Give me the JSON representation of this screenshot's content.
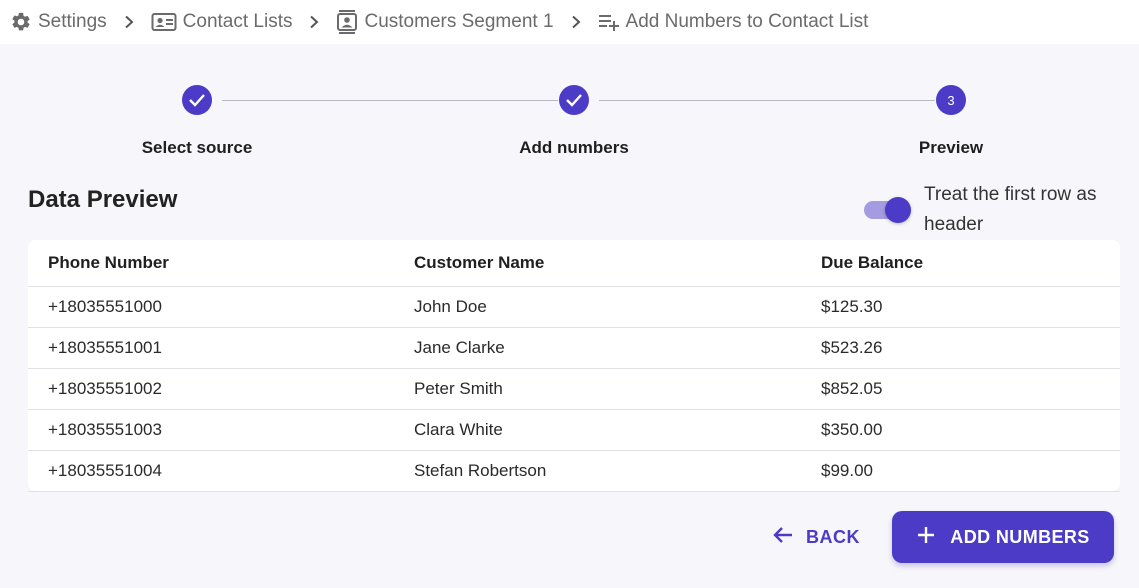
{
  "breadcrumb": {
    "items": [
      {
        "label": "Settings",
        "icon": "gear-icon"
      },
      {
        "label": "Contact Lists",
        "icon": "contact-card-icon"
      },
      {
        "label": "Customers Segment 1",
        "icon": "contact-list-icon"
      },
      {
        "label": "Add Numbers to Contact List",
        "icon": "playlist-add-icon"
      }
    ]
  },
  "stepper": {
    "steps": [
      {
        "label": "Select source",
        "state": "completed"
      },
      {
        "label": "Add numbers",
        "state": "completed"
      },
      {
        "label": "Preview",
        "state": "active",
        "number": "3"
      }
    ]
  },
  "preview": {
    "title": "Data Preview",
    "toggle_label": "Treat the first row as header",
    "toggle_on": true
  },
  "table": {
    "headers": [
      "Phone Number",
      "Customer Name",
      "Due Balance"
    ],
    "rows": [
      [
        "+18035551000",
        "John Doe",
        "$125.30"
      ],
      [
        "+18035551001",
        "Jane Clarke",
        "$523.26"
      ],
      [
        "+18035551002",
        "Peter Smith",
        "$852.05"
      ],
      [
        "+18035551003",
        "Clara White",
        "$350.00"
      ],
      [
        "+18035551004",
        "Stefan Robertson",
        "$99.00"
      ]
    ]
  },
  "actions": {
    "back_label": "BACK",
    "add_label": "ADD NUMBERS"
  },
  "colors": {
    "accent": "#4b3bc6",
    "background": "#f7f7fb"
  }
}
